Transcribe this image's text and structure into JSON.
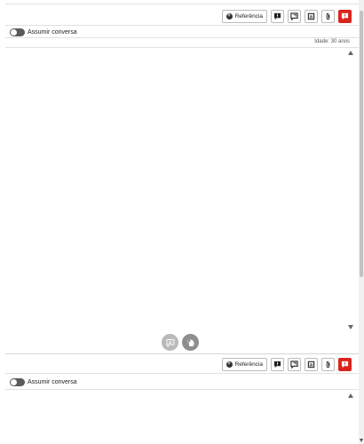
{
  "panels": [
    {
      "reference_label": "Referência",
      "toggle_label": "Assumir conversa",
      "age_text": "Idade: 30 anos"
    },
    {
      "reference_label": "Referência",
      "toggle_label": "Assumir conversa"
    }
  ],
  "icons": {
    "toolbar": [
      "plus-circle-icon",
      "chat-alert-icon",
      "chat-reply-icon",
      "document-icon",
      "attachment-icon",
      "flag-icon"
    ],
    "fabs": [
      "comment-icon",
      "hand-wave-icon"
    ]
  },
  "colors": {
    "accent_red": "#d9251d",
    "toggle_off": "#5b5b5b"
  }
}
